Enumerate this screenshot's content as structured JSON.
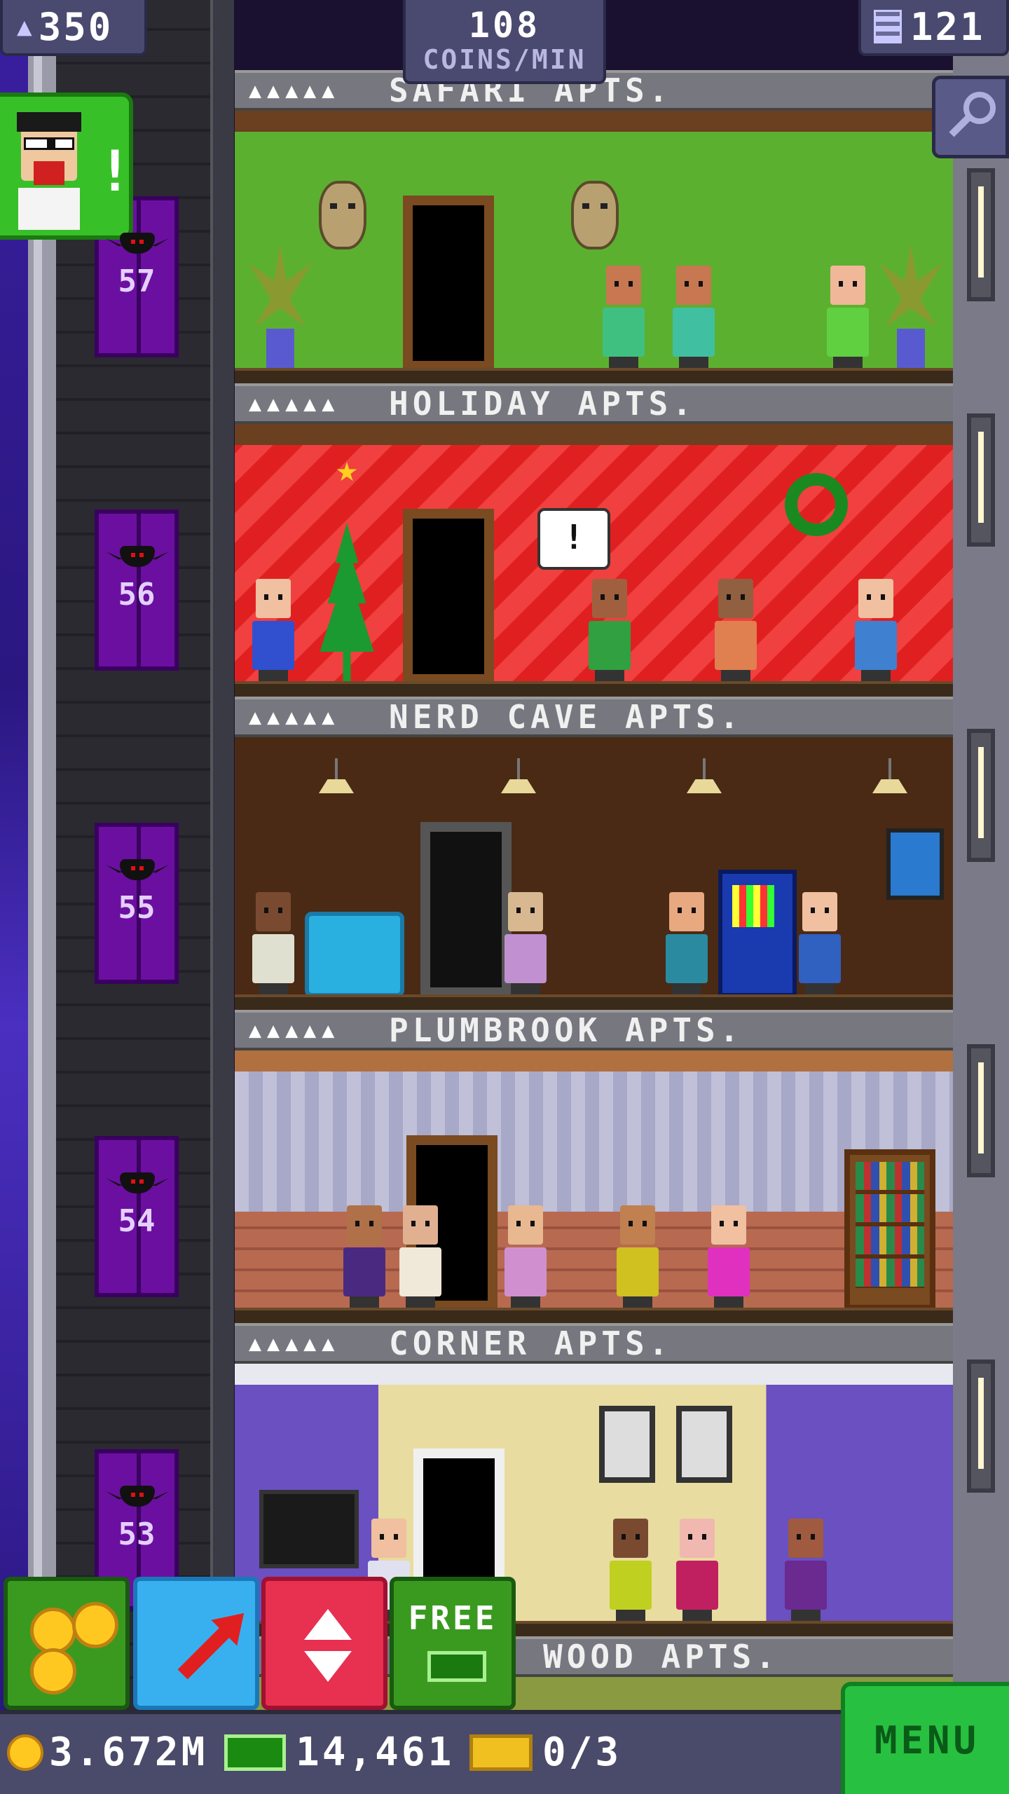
{
  "hud": {
    "population": "350",
    "coins_per_min_value": "108",
    "coins_per_min_unit": "COINS/MIN",
    "floor_count": "121"
  },
  "elevator": {
    "floor_numbers": [
      "57",
      "56",
      "55",
      "54",
      "53"
    ]
  },
  "floors": [
    {
      "name": "SAFARI APTS.",
      "resident_slots": "▲▲▲▲▲"
    },
    {
      "name": "HOLIDAY APTS.",
      "resident_slots": "▲▲▲▲▲"
    },
    {
      "name": "NERD CAVE APTS.",
      "resident_slots": "▲▲▲▲▲"
    },
    {
      "name": "PLUMBROOK APTS.",
      "resident_slots": "▲▲▲▲▲"
    },
    {
      "name": "CORNER APTS.",
      "resident_slots": "▲▲▲▲▲"
    },
    {
      "name": "WOOD APTS.",
      "resident_slots": ""
    }
  ],
  "holiday_bubble": "!",
  "vip_alert": "!",
  "actions": {
    "free_label": "FREE"
  },
  "status": {
    "coins": "3.672M",
    "tower_bux": "14,461",
    "tickets": "0/3"
  },
  "menu_label": "MENU",
  "colors": {
    "elevator": "#6b0fa0",
    "menu_green": "#28c040",
    "hud": "#4a4a70"
  },
  "icons": [
    "person-icon",
    "building-icon",
    "search-icon",
    "coin-icon",
    "bux-icon",
    "ticket-icon",
    "rocket-icon",
    "elevator-icon",
    "bat-icon"
  ]
}
